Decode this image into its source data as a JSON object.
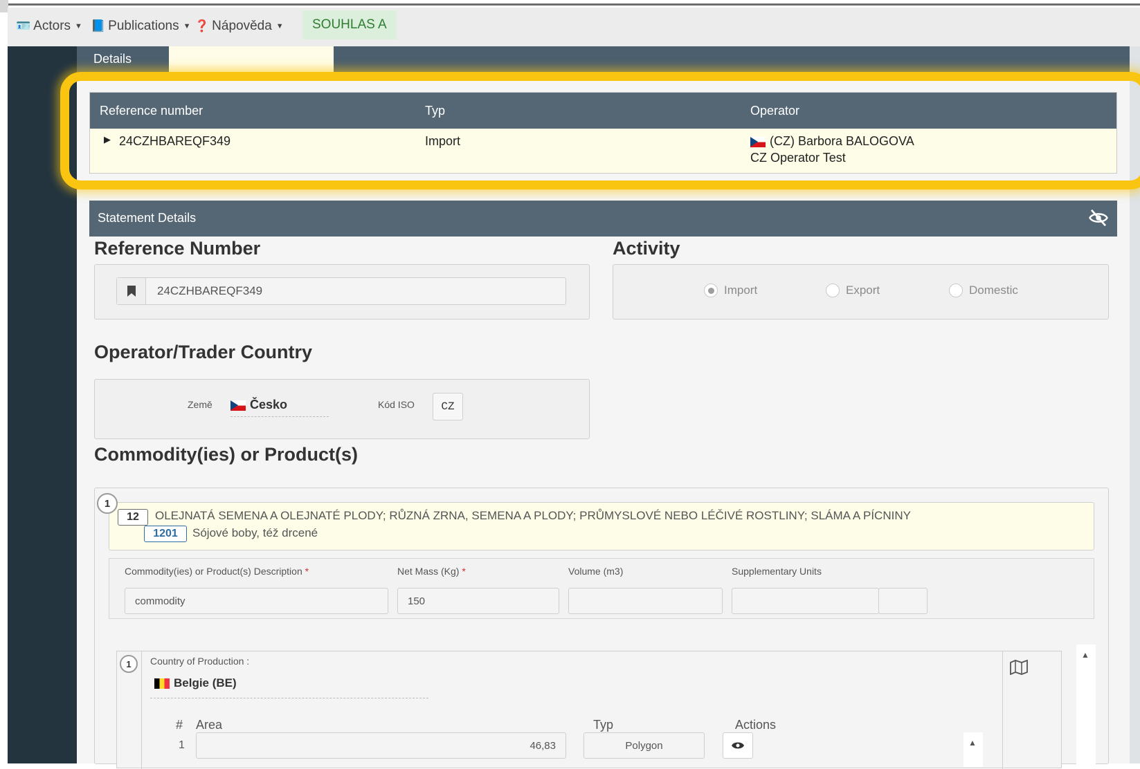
{
  "navbar": {
    "actors": "Actors",
    "publications": "Publications",
    "help": "Nápověda",
    "souhlas": "SOUHLAS A"
  },
  "tabs": {
    "details": "Details"
  },
  "ref_table": {
    "headers": [
      "Reference number",
      "Typ",
      "Operator"
    ],
    "row": {
      "reference": "24CZHBAREQF349",
      "typ": "Import",
      "operator_name": "(CZ) Barbora BALOGOVA",
      "operator_org": "CZ Operator Test"
    }
  },
  "statement": {
    "title": "Statement Details",
    "reference_section": "Reference Number",
    "reference_value": "24CZHBAREQF349",
    "activity_section": "Activity",
    "activity_options": [
      "Import",
      "Export",
      "Domestic"
    ],
    "activity_selected": "Import",
    "country_section": "Operator/Trader Country",
    "country_label": "Země",
    "country_value": "Česko",
    "iso_label": "Kód ISO",
    "iso_value": "CZ",
    "commodity_section": "Commodity(ies) or Product(s)",
    "commodity_index": "1",
    "hs_chapter_code": "12",
    "hs_chapter_text": "OLEJNATÁ SEMENA A OLEJNATÉ PLODY; RŮZNÁ ZRNA, SEMENA A PLODY; PRŮMYSLOVÉ NEBO LÉČIVÉ ROSTLINY; SLÁMA A PÍCNINY",
    "hs_heading_code": "1201",
    "hs_heading_text": "Sójové boby, též drcené",
    "fields": {
      "description_label": "Commodity(ies) or Product(s) Description",
      "description_value": "commodity",
      "net_mass_label": "Net Mass (Kg)",
      "net_mass_value": "150",
      "volume_label": "Volume (m3)",
      "volume_value": "",
      "supp_units_label": "Supplementary Units",
      "supp_units_value": "",
      "required_mark": "*"
    },
    "production": {
      "index": "1",
      "label": "Country of Production :",
      "country": "Belgie (BE)",
      "table_headers": [
        "#",
        "Area",
        "Typ",
        "Actions"
      ],
      "rows": [
        {
          "num": "1",
          "area": "46,83",
          "typ": "Polygon"
        }
      ]
    }
  },
  "colors": {
    "header_bar": "#556775",
    "highlight": "#f9c510",
    "panel_bg": "#fdfde8"
  }
}
